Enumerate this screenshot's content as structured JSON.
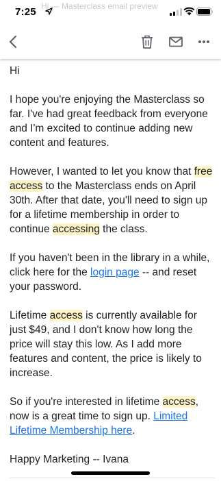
{
  "status_bar": {
    "time": "7:25",
    "ghost_line": "Hi — Masterclass email preview"
  },
  "icons": {
    "location": "location-arrow-icon",
    "signal": "cellular-signal-icon",
    "wifi": "wifi-icon",
    "battery": "battery-icon",
    "back": "chevron-left-icon",
    "delete": "trash-icon",
    "mail": "envelope-icon",
    "more": "more-horizontal-icon"
  },
  "colors": {
    "highlight": "#fdf3c6",
    "link": "#1a73e8"
  },
  "email": {
    "greeting": "Hi",
    "p1": "I hope you're enjoying the Masterclass so far. I've had great feedback from everyone and I'm excited to continue adding new content and features.",
    "p2": {
      "t1": "However, I wanted to let you know that ",
      "h1": "free access",
      "t2": " to the Masterclass ends on April 30th. After that date, you'll need to sign up for a lifetime membership in order to continue ",
      "h2": "accessing",
      "t3": " the class."
    },
    "p3": {
      "t1": "If you haven't been in the library in a while, click here for the ",
      "link": "login page",
      "t2": " -- and reset your password."
    },
    "p4": {
      "t1": "Lifetime ",
      "h1": "access",
      "t2": " is currently available for just $49, and I don't know how long the price will stay this low. As I add more features and content, the price is likely to increase."
    },
    "p5": {
      "t1": "So if you're interested in lifetime ",
      "h1": "access",
      "t2": ", now is a great time to sign up. ",
      "link": "Limited Lifetime Membership here",
      "t3": "."
    },
    "signoff": "Happy Marketing -- Ivana"
  }
}
